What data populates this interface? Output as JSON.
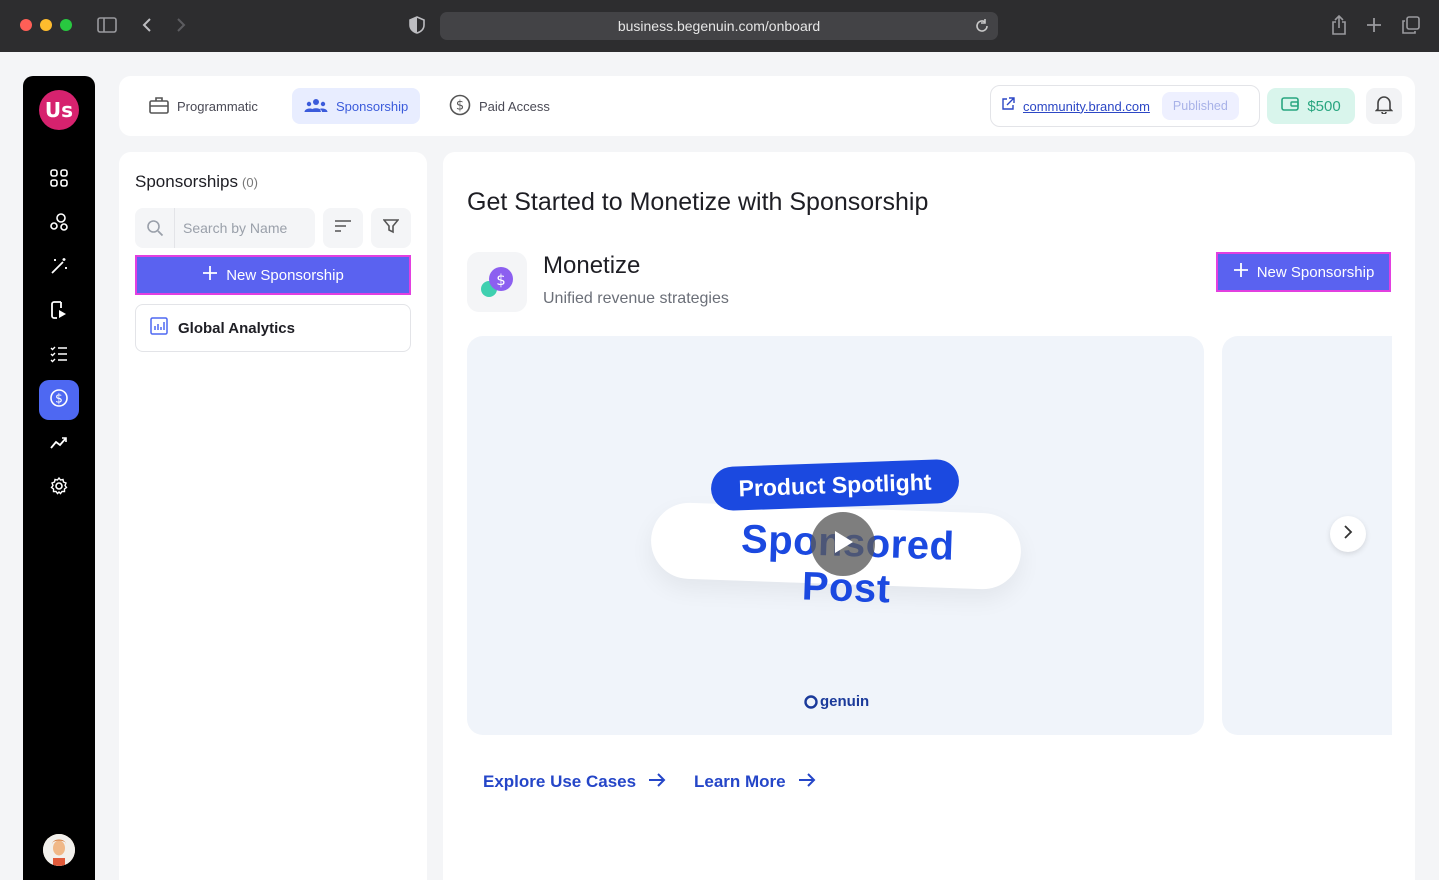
{
  "browser": {
    "url": "business.begenuin.com/onboard"
  },
  "sidebar": {
    "logo_text": "Us",
    "items": [
      {
        "icon": "grid-icon"
      },
      {
        "icon": "community-icon"
      },
      {
        "icon": "magic-wand-icon"
      },
      {
        "icon": "video-icon"
      },
      {
        "icon": "list-icon"
      },
      {
        "icon": "dollar-icon",
        "active": true
      },
      {
        "icon": "analytics-icon"
      },
      {
        "icon": "gear-icon"
      }
    ]
  },
  "topnav": {
    "tabs": [
      {
        "label": "Programmatic",
        "icon": "briefcase-icon"
      },
      {
        "label": "Sponsorship",
        "icon": "people-icon",
        "active": true
      },
      {
        "label": "Paid Access",
        "icon": "dollar-circle-icon"
      }
    ],
    "site_link": "community.brand.com",
    "status_badge": "Published",
    "wallet_amount": "$500"
  },
  "left_panel": {
    "title": "Sponsorships",
    "count": "(0)",
    "search_placeholder": "Search by Name",
    "new_button_label": "New Sponsorship",
    "analytics_label": "Global Analytics"
  },
  "main": {
    "heading": "Get Started to Monetize with Sponsorship",
    "section_title": "Monetize",
    "section_subtitle": "Unified revenue strategies",
    "new_button_label": "New Sponsorship",
    "video": {
      "pill_text": "Product Spotlight",
      "headline": "Sponsored Post",
      "brand": "genuin"
    },
    "links": [
      {
        "label": "Explore Use Cases"
      },
      {
        "label": "Learn More"
      }
    ]
  },
  "colors": {
    "accent": "#5a62f0",
    "highlight_border": "#e23fe0",
    "sidebar_bg": "#000000",
    "active_sidebar": "#4e68f2",
    "link": "#2546c8"
  }
}
